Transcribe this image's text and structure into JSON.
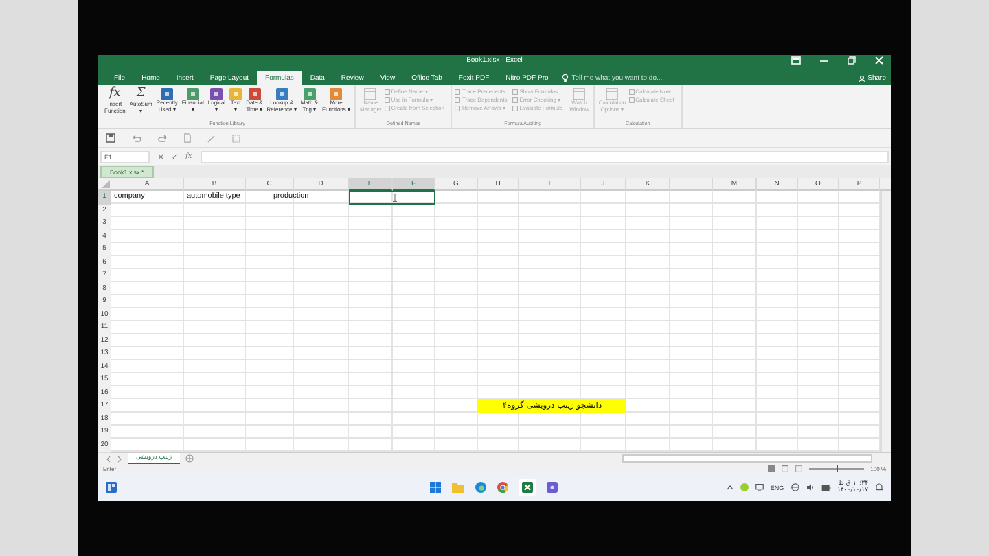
{
  "window": {
    "title": "Book1.xlsx - Excel"
  },
  "ribbon_tabs": [
    {
      "label": "File",
      "selected": false
    },
    {
      "label": "Home",
      "selected": false
    },
    {
      "label": "Insert",
      "selected": false
    },
    {
      "label": "Page Layout",
      "selected": false
    },
    {
      "label": "Formulas",
      "selected": true
    },
    {
      "label": "Data",
      "selected": false
    },
    {
      "label": "Review",
      "selected": false
    },
    {
      "label": "View",
      "selected": false
    },
    {
      "label": "Office Tab",
      "selected": false
    },
    {
      "label": "Foxit PDF",
      "selected": false
    },
    {
      "label": "Nitro PDF Pro",
      "selected": false
    }
  ],
  "tell_me": {
    "placeholder": "Tell me what you want to do..."
  },
  "share": "Share",
  "ribbon_groups": [
    {
      "label": "Function Library",
      "buttons": [
        {
          "kind": "large",
          "label": "Insert\nFunction",
          "glyph": "fx",
          "disabled": false
        },
        {
          "kind": "large",
          "label": "AutoSum\n▾",
          "glyph": "Σ",
          "disabled": false
        },
        {
          "kind": "large",
          "label": "Recently\nUsed ▾",
          "color": "#2e6db4",
          "disabled": false
        },
        {
          "kind": "large",
          "label": "Financial\n▾",
          "color": "#4f9a6b",
          "disabled": false
        },
        {
          "kind": "large",
          "label": "Logical\n▾",
          "color": "#7a4fb0",
          "disabled": false
        },
        {
          "kind": "large",
          "label": "Text\n▾",
          "color": "#e8b43a",
          "disabled": false
        },
        {
          "kind": "large",
          "label": "Date &\nTime ▾",
          "color": "#cc4a3a",
          "disabled": false
        },
        {
          "kind": "large",
          "label": "Lookup &\nReference ▾",
          "color": "#3a7cc0",
          "disabled": false
        },
        {
          "kind": "large",
          "label": "Math &\nTrig ▾",
          "color": "#4aa06a",
          "disabled": false
        },
        {
          "kind": "large",
          "label": "More\nFunctions ▾",
          "color": "#e08a3a",
          "disabled": false
        }
      ]
    },
    {
      "label": "Defined Names",
      "buttons": [
        {
          "kind": "large",
          "label": "Name\nManager",
          "disabled": true
        },
        {
          "kind": "small",
          "label": "Define Name ▾",
          "disabled": true
        },
        {
          "kind": "small",
          "label": "Use in Formula ▾",
          "disabled": true
        },
        {
          "kind": "small",
          "label": "Create from Selection",
          "disabled": true
        }
      ]
    },
    {
      "label": "Formula Auditing",
      "buttons": [
        {
          "kind": "small",
          "label": "Trace Precedents",
          "disabled": true
        },
        {
          "kind": "small",
          "label": "Trace Dependents",
          "disabled": true
        },
        {
          "kind": "small",
          "label": "Remove Arrows ▾",
          "disabled": true
        },
        {
          "kind": "small",
          "label": "Show Formulas",
          "disabled": true
        },
        {
          "kind": "small",
          "label": "Error Checking ▾",
          "disabled": true
        },
        {
          "kind": "small",
          "label": "Evaluate Formula",
          "disabled": true
        },
        {
          "kind": "large",
          "label": "Watch\nWindow",
          "disabled": true
        }
      ]
    },
    {
      "label": "Calculation",
      "buttons": [
        {
          "kind": "large",
          "label": "Calculation\nOptions ▾",
          "disabled": true
        },
        {
          "kind": "small",
          "label": "Calculate Now",
          "disabled": true
        },
        {
          "kind": "small",
          "label": "Calculate Sheet",
          "disabled": true
        }
      ]
    }
  ],
  "formula_bar": {
    "name_box": "E1",
    "cancel": "✕",
    "enter": "✓",
    "fx": "fx"
  },
  "workbook_tab": {
    "label": "Book1.xlsx *"
  },
  "columns": [
    {
      "label": "A",
      "selected": false
    },
    {
      "label": "B",
      "selected": false
    },
    {
      "label": "C",
      "selected": false
    },
    {
      "label": "D",
      "selected": false
    },
    {
      "label": "E",
      "selected": true
    },
    {
      "label": "F",
      "selected": true
    },
    {
      "label": "G",
      "selected": false
    },
    {
      "label": "H",
      "selected": false
    },
    {
      "label": "I",
      "selected": false
    },
    {
      "label": "J",
      "selected": false
    },
    {
      "label": "K",
      "selected": false
    },
    {
      "label": "L",
      "selected": false
    },
    {
      "label": "M",
      "selected": false
    },
    {
      "label": "N",
      "selected": false
    },
    {
      "label": "O",
      "selected": false
    },
    {
      "label": "P",
      "selected": false
    }
  ],
  "rows": [
    {
      "label": "1",
      "selected": true,
      "cells": [
        {
          "kind": "text",
          "text": "company"
        },
        {
          "kind": "text",
          "text": "automobile type"
        },
        {
          "kind": "text",
          "text": "production"
        }
      ]
    },
    {
      "label": "2",
      "selected": false
    },
    {
      "label": "3",
      "selected": false
    },
    {
      "label": "4",
      "selected": false
    },
    {
      "label": "5",
      "selected": false
    },
    {
      "label": "6",
      "selected": false
    },
    {
      "label": "7",
      "selected": false
    },
    {
      "label": "8",
      "selected": false
    },
    {
      "label": "9",
      "selected": false
    },
    {
      "label": "10",
      "selected": false
    },
    {
      "label": "11",
      "selected": false
    },
    {
      "label": "12",
      "selected": false
    },
    {
      "label": "13",
      "selected": false
    },
    {
      "label": "14",
      "selected": false
    },
    {
      "label": "15",
      "selected": false
    },
    {
      "label": "16",
      "selected": false
    },
    {
      "label": "17",
      "selected": false,
      "cells": [
        {
          "kind": "banner",
          "text": "دانشجو   زینب درویشی   گروه۴",
          "highlighted": true
        }
      ]
    },
    {
      "label": "18",
      "selected": false
    },
    {
      "label": "19",
      "selected": false
    },
    {
      "label": "20",
      "selected": false
    }
  ],
  "sheet_tabs": [
    {
      "label": "زینب درویشی",
      "selected": true
    }
  ],
  "status_bar": {
    "mode": "Enter",
    "zoom_slider": {
      "level": 0.5
    },
    "zoom": "100 %"
  },
  "taskbar": {
    "language": "ENG",
    "time": "۱۰:۳۴ ق.ظ",
    "date": "۱۴۰۰/۱۰/۱۷"
  }
}
